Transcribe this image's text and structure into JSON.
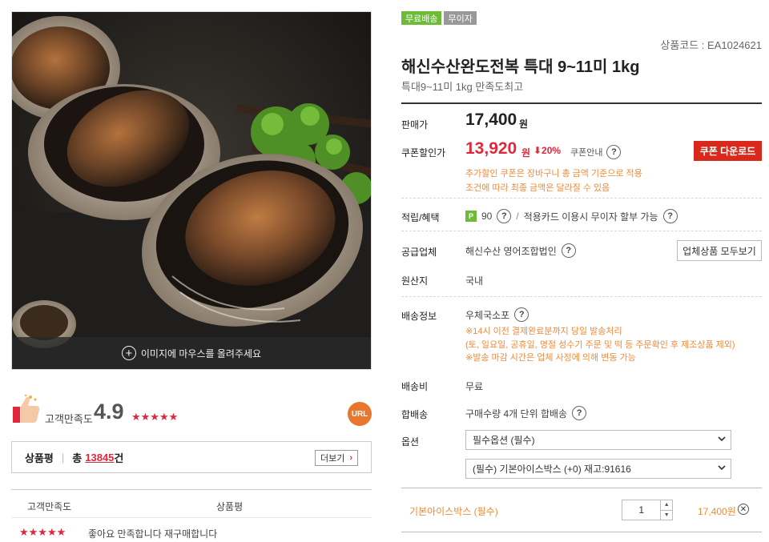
{
  "image_overlay": {
    "text": "이미지에 마우스를 올려주세요"
  },
  "satisfaction": {
    "label": "고객만족도",
    "score": "4.9",
    "stars": "★★★★★",
    "rating": 4.9
  },
  "url_badge": "URL",
  "review_summary": {
    "title": "상품평",
    "total_prefix": "총",
    "count": "13845",
    "unit": "건",
    "more_label": "더보기"
  },
  "review_table": {
    "headers": [
      "고객만족도",
      "상품평"
    ],
    "rows": [
      {
        "stars": "★★★★★",
        "text": "좋아요 만족합니다 재구매합니다"
      }
    ]
  },
  "badges": [
    "무료배송",
    "무이자"
  ],
  "product": {
    "code": "상품코드 : EA1024621",
    "title": "해신수산완도전복 특대 9~11미 1kg",
    "subtitle": "특대9~11미 1kg 만족도최고"
  },
  "price": {
    "label": "판매가",
    "value": "17,400",
    "unit": "원"
  },
  "coupon_price": {
    "label": "쿠폰할인가",
    "value": "13,920",
    "unit": "원",
    "discount": "⬇20%",
    "info_label": "쿠폰안내",
    "button": "쿠폰 다운로드",
    "notes": [
      "추가할인 쿠폰은 장바구니 총 금액 기준으로 적용",
      "조건에 따라 최종 금액은 달라질 수 있음"
    ]
  },
  "points": {
    "label": "적립/혜택",
    "icon_letter": "P",
    "value": "90",
    "card_text": "적용카드 이용시 무이자 할부 가능"
  },
  "supplier": {
    "label": "공급업체",
    "name": "해신수산 영어조합법인",
    "button": "업체상품 모두보기"
  },
  "origin": {
    "label": "원산지",
    "value": "국내"
  },
  "shipping": {
    "label": "배송정보",
    "method": "우체국소포",
    "notes": [
      "※14시 이전 결제완료분까지 당일 발송처리",
      "(토, 일요일, 공휴일, 명절 성수기 주문 및 떡 등 주문확인 후 제조상품 제외)",
      "※발송 마감 시간은 업체 사정에 의해 변동 가능"
    ]
  },
  "shipping_fee": {
    "label": "배송비",
    "value": "무료"
  },
  "bundle": {
    "label": "합배송",
    "value": "구매수량 4개 단위 합배송"
  },
  "options": {
    "label": "옵션",
    "select1": "필수옵션 (필수)",
    "select2": "(필수) 기본아이스박스 (+0) 재고:91616"
  },
  "selected_option": {
    "name": "기본아이스박스 (필수)",
    "qty": "1",
    "price": "17,400원"
  },
  "colors": {
    "accent_red": "#e0283c",
    "coupon_button": "#d9291c",
    "orange_text": "#f08a3a",
    "green_badge": "#6cbc38",
    "gray_badge": "#999999",
    "url_badge": "#e8762c"
  }
}
